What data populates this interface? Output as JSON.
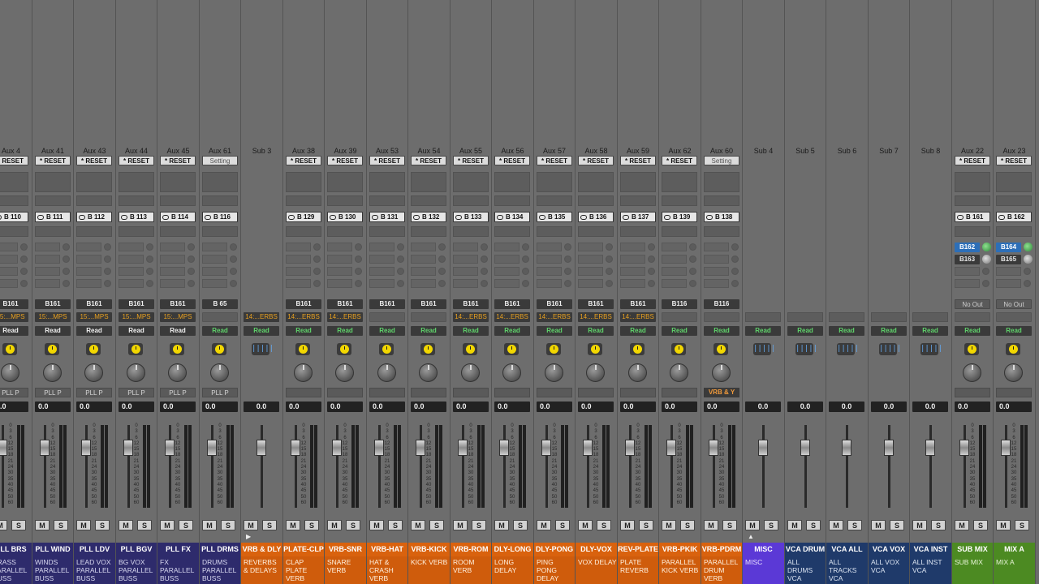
{
  "window": {
    "title": "Mixer"
  },
  "labels": {
    "mute": "M",
    "solo": "S",
    "wave": "|||||"
  },
  "fader_scale": [
    "0",
    "3",
    "6",
    "12",
    "15",
    "18",
    "21",
    "24",
    "30",
    "35",
    "40",
    "45",
    "50",
    "60"
  ],
  "colors": {
    "purple": "#2e2b6c",
    "orange": "#d9620e",
    "misc": "#5b39d6",
    "navy": "#1f3a6a",
    "green": "#4c8a22",
    "send_active": "#2d6fb8",
    "plugin_dial": "#f2d700",
    "automation_green": "#5fd46b",
    "group_text": "#e8a020"
  },
  "strips": [
    {
      "name": "Aux 4",
      "type": "aux",
      "reset": "* RESET",
      "bus": "B 110",
      "io": "B161",
      "group": "15:...MPS",
      "auto": "Read",
      "auto_style": "read",
      "plugin": "dial",
      "pan": true,
      "pll": "PLL P",
      "vol": "0.0",
      "bname": "PLL BRS",
      "bcomm": "BRASS PARALLEL BUSS",
      "color": "purple"
    },
    {
      "name": "Aux 41",
      "type": "aux",
      "reset": "* RESET",
      "bus": "B 111",
      "io": "B161",
      "group": "15:...MPS",
      "auto": "Read",
      "auto_style": "read",
      "plugin": "dial",
      "pan": true,
      "pll": "PLL P",
      "vol": "0.0",
      "bname": "PLL WIND",
      "bcomm": "WINDS PARALLEL BUSS",
      "color": "purple"
    },
    {
      "name": "Aux 43",
      "type": "aux",
      "reset": "* RESET",
      "bus": "B 112",
      "io": "B161",
      "group": "15:...MPS",
      "auto": "Read",
      "auto_style": "read",
      "plugin": "dial",
      "pan": true,
      "pll": "PLL P",
      "vol": "0.0",
      "bname": "PLL LDV",
      "bcomm": "LEAD VOX PARALLEL BUSS",
      "color": "purple"
    },
    {
      "name": "Aux 44",
      "type": "aux",
      "reset": "* RESET",
      "bus": "B 113",
      "io": "B161",
      "group": "15:...MPS",
      "auto": "Read",
      "auto_style": "read",
      "plugin": "dial",
      "pan": true,
      "pll": "PLL P",
      "vol": "0.0",
      "bname": "PLL BGV",
      "bcomm": "BG VOX PARALLEL BUSS",
      "color": "purple"
    },
    {
      "name": "Aux 45",
      "type": "aux",
      "reset": "* RESET",
      "bus": "B 114",
      "io": "B161",
      "group": "15:...MPS",
      "auto": "Read",
      "auto_style": "read",
      "plugin": "dial",
      "pan": true,
      "pll": "PLL P",
      "vol": "0.0",
      "bname": "PLL FX",
      "bcomm": "FX PARALLEL BUSS",
      "color": "purple"
    },
    {
      "name": "Aux 61",
      "type": "aux",
      "reset": "Setting",
      "bus": "B 116",
      "io": "B 65",
      "group": "",
      "auto": "Read",
      "auto_style": "green",
      "plugin": "dial",
      "pan": true,
      "pll": "PLL P",
      "vol": "0.0",
      "bname": "PLL DRMS",
      "bcomm": "DRUMS PARALLEL BUSS",
      "color": "purple"
    },
    {
      "name": "Sub 3",
      "type": "sub",
      "group": "14:...ERBS",
      "auto": "Read",
      "auto_style": "green",
      "plugin": "wave",
      "vol": "0.0",
      "bname": "VRB & DLY",
      "bcomm": "REVERBS & DELAYS",
      "color": "orange",
      "arrow": "▶"
    },
    {
      "name": "Aux 38",
      "type": "aux",
      "reset": "* RESET",
      "bus": "B 129",
      "io": "B161",
      "group": "14:...ERBS",
      "auto": "Read",
      "auto_style": "green",
      "plugin": "dial",
      "pan": true,
      "pll": "",
      "vol": "0.0",
      "bname": "PLATE-CLP",
      "bcomm": "CLAP PLATE VERB",
      "color": "orange"
    },
    {
      "name": "Aux 39",
      "type": "aux",
      "reset": "* RESET",
      "bus": "B 130",
      "io": "B161",
      "group": "14:...ERBS",
      "auto": "Read",
      "auto_style": "green",
      "plugin": "dial",
      "pan": true,
      "pll": "",
      "vol": "0.0",
      "bname": "VRB-SNR",
      "bcomm": "SNARE VERB",
      "color": "orange"
    },
    {
      "name": "Aux 53",
      "type": "aux",
      "reset": "* RESET",
      "bus": "B 131",
      "io": "B161",
      "group": "",
      "auto": "Read",
      "auto_style": "green",
      "plugin": "dial",
      "pan": true,
      "pll": "",
      "vol": "0.0",
      "bname": "VRB-HAT",
      "bcomm": "HAT & CRASH VERB",
      "color": "orange"
    },
    {
      "name": "Aux 54",
      "type": "aux",
      "reset": "* RESET",
      "bus": "B 132",
      "io": "B161",
      "group": "",
      "auto": "Read",
      "auto_style": "green",
      "plugin": "dial",
      "pan": true,
      "pll": "",
      "vol": "0.0",
      "bname": "VRB-KICK",
      "bcomm": "KICK VERB",
      "color": "orange"
    },
    {
      "name": "Aux 55",
      "type": "aux",
      "reset": "* RESET",
      "bus": "B 133",
      "io": "B161",
      "group": "14:...ERBS",
      "auto": "Read",
      "auto_style": "green",
      "plugin": "dial",
      "pan": true,
      "pll": "",
      "vol": "0.0",
      "bname": "VRB-ROM",
      "bcomm": "ROOM VERB",
      "color": "orange"
    },
    {
      "name": "Aux 56",
      "type": "aux",
      "reset": "* RESET",
      "bus": "B 134",
      "io": "B161",
      "group": "14:...ERBS",
      "auto": "Read",
      "auto_style": "green",
      "plugin": "dial",
      "pan": true,
      "pll": "",
      "vol": "0.0",
      "bname": "DLY-LONG",
      "bcomm": "LONG DELAY",
      "color": "orange"
    },
    {
      "name": "Aux 57",
      "type": "aux",
      "reset": "* RESET",
      "bus": "B 135",
      "io": "B161",
      "group": "14:...ERBS",
      "auto": "Read",
      "auto_style": "green",
      "plugin": "dial",
      "pan": true,
      "pll": "",
      "vol": "0.0",
      "bname": "DLY-PONG",
      "bcomm": "PING PONG DELAY",
      "color": "orange"
    },
    {
      "name": "Aux 58",
      "type": "aux",
      "reset": "* RESET",
      "bus": "B 136",
      "io": "B161",
      "group": "14:...ERBS",
      "auto": "Read",
      "auto_style": "green",
      "plugin": "dial",
      "pan": true,
      "pll": "",
      "vol": "0.0",
      "bname": "DLY-VOX",
      "bcomm": "VOX DELAY",
      "color": "orange"
    },
    {
      "name": "Aux 59",
      "type": "aux",
      "reset": "* RESET",
      "bus": "B 137",
      "io": "B161",
      "group": "14:...ERBS",
      "auto": "Read",
      "auto_style": "green",
      "plugin": "dial",
      "pan": true,
      "pll": "",
      "vol": "0.0",
      "bname": "REV-PLATE",
      "bcomm": "PLATE REVERB",
      "color": "orange"
    },
    {
      "name": "Aux 62",
      "type": "aux",
      "reset": "* RESET",
      "bus": "B 139",
      "io": "B116",
      "group": "",
      "auto": "Read",
      "auto_style": "green",
      "plugin": "dial",
      "pan": true,
      "pll": "",
      "vol": "0.0",
      "bname": "VRB-PKIK",
      "bcomm": "PARALLEL KICK VERB",
      "color": "orange"
    },
    {
      "name": "Aux 60",
      "type": "aux",
      "reset": "Setting",
      "bus": "B 138",
      "io": "B116",
      "group": "",
      "auto": "Read",
      "auto_style": "green",
      "plugin": "dial",
      "pan": true,
      "pll": "VRB & Y",
      "pll_style": "orange",
      "vol": "0.0",
      "bname": "VRB-PDRM",
      "bcomm": "PARALLEL DRUM VERB",
      "color": "orange"
    },
    {
      "name": "Sub 4",
      "type": "sub",
      "group": "",
      "auto": "Read",
      "auto_style": "green",
      "plugin": "wave",
      "vol": "0.0",
      "bname": "MISC",
      "bcomm": "MISC",
      "color": "misc",
      "arrow": "▲"
    },
    {
      "name": "Sub 5",
      "type": "sub",
      "group": "",
      "auto": "Read",
      "auto_style": "green",
      "plugin": "wave",
      "vol": "0.0",
      "bname": "VCA DRUM",
      "bcomm": "ALL DRUMS VCA",
      "color": "navy"
    },
    {
      "name": "Sub 6",
      "type": "sub",
      "group": "",
      "auto": "Read",
      "auto_style": "green",
      "plugin": "wave",
      "vol": "0.0",
      "bname": "VCA ALL",
      "bcomm": "ALL TRACKS VCA",
      "color": "navy"
    },
    {
      "name": "Sub 7",
      "type": "sub",
      "group": "",
      "auto": "Read",
      "auto_style": "green",
      "plugin": "wave",
      "vol": "0.0",
      "bname": "VCA VOX",
      "bcomm": "ALL VOX VCA",
      "color": "navy"
    },
    {
      "name": "Sub 8",
      "type": "sub",
      "group": "",
      "auto": "Read",
      "auto_style": "green",
      "plugin": "wave",
      "vol": "0.0",
      "bname": "VCA INST",
      "bcomm": "ALL INST VCA",
      "color": "navy"
    },
    {
      "name": "Aux 22",
      "type": "aux",
      "reset": "* RESET",
      "bus": "B 161",
      "io": "No Out",
      "io_style": "noout",
      "sends": [
        "B162",
        "B163"
      ],
      "group": "",
      "auto": "Read",
      "auto_style": "green",
      "plugin": "dial",
      "pan": true,
      "pll": "",
      "vol": "0.0",
      "bname": "SUB MIX",
      "bcomm": "SUB MIX",
      "color": "green"
    },
    {
      "name": "Aux 23",
      "type": "aux",
      "reset": "* RESET",
      "bus": "B 162",
      "io": "No Out",
      "io_style": "noout",
      "sends": [
        "B164",
        "B165"
      ],
      "group": "",
      "auto": "Read",
      "auto_style": "green",
      "plugin": "dial",
      "pan": true,
      "pll": "",
      "vol": "0.0",
      "bname": "MIX A",
      "bcomm": "MIX A",
      "color": "green"
    }
  ]
}
